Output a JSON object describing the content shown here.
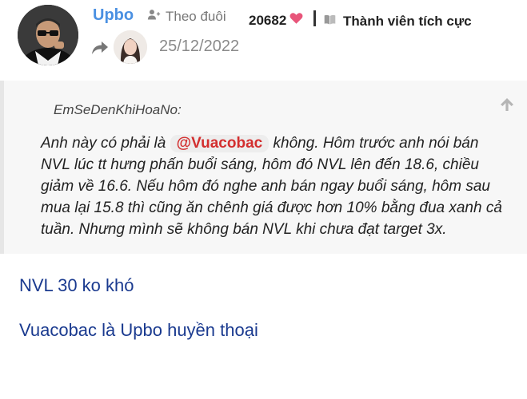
{
  "post": {
    "username": "Upbo",
    "follow_label": "Theo đuôi",
    "score": "20682",
    "member_title": "Thành viên tích cực",
    "date": "25/12/2022"
  },
  "quote": {
    "author": "EmSeDenKhiHoaNo:",
    "text_before": "Anh này có phải là ",
    "mention": "@Vuacobac",
    "text_after": " không. Hôm trước anh nói bán NVL lúc tt hưng phấn buổi sáng, hôm đó NVL lên đến 18.6, chiều giảm về 16.6. Nếu hôm đó nghe anh bán ngay buổi sáng, hôm sau mua lại 15.8 thì cũng ăn chênh giá được hơn 10% bằng đua xanh cả tuần. Nhưng mình sẽ không bán NVL khi chưa đạt target 3x."
  },
  "reply": {
    "line1": "NVL 30 ko khó",
    "line2": "Vuacobac là Upbo huyền thoại"
  },
  "icons": {
    "follow": "person-plus-icon",
    "score": "heart-icon",
    "member": "book-icon",
    "reply": "reply-arrow-icon",
    "quote_expand": "arrow-up-icon"
  },
  "colors": {
    "username": "#4a90e2",
    "heart": "#e8557a",
    "mention": "#d32f2f",
    "reply_text": "#1a3a8f",
    "quote_bg": "#f7f7f7"
  }
}
